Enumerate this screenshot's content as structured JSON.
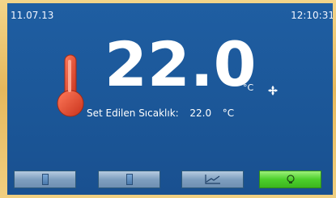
{
  "status": {
    "date": "11.07.13",
    "time": "12:10:31"
  },
  "main": {
    "temperature": "22.0",
    "unit": "°C",
    "set_label": "Set Edilen Sıcaklık:",
    "set_value": "22.0",
    "set_unit": "°C"
  },
  "icons": {
    "thermometer": "thermometer-icon",
    "fan": "fan-icon",
    "trend": "trend-chart-icon",
    "light": "bulb-icon"
  },
  "colors": {
    "screen": "#1b5697",
    "thermometer": "#e24a2f",
    "button": "#8aa9c8",
    "active_button": "#4ccf2b"
  }
}
